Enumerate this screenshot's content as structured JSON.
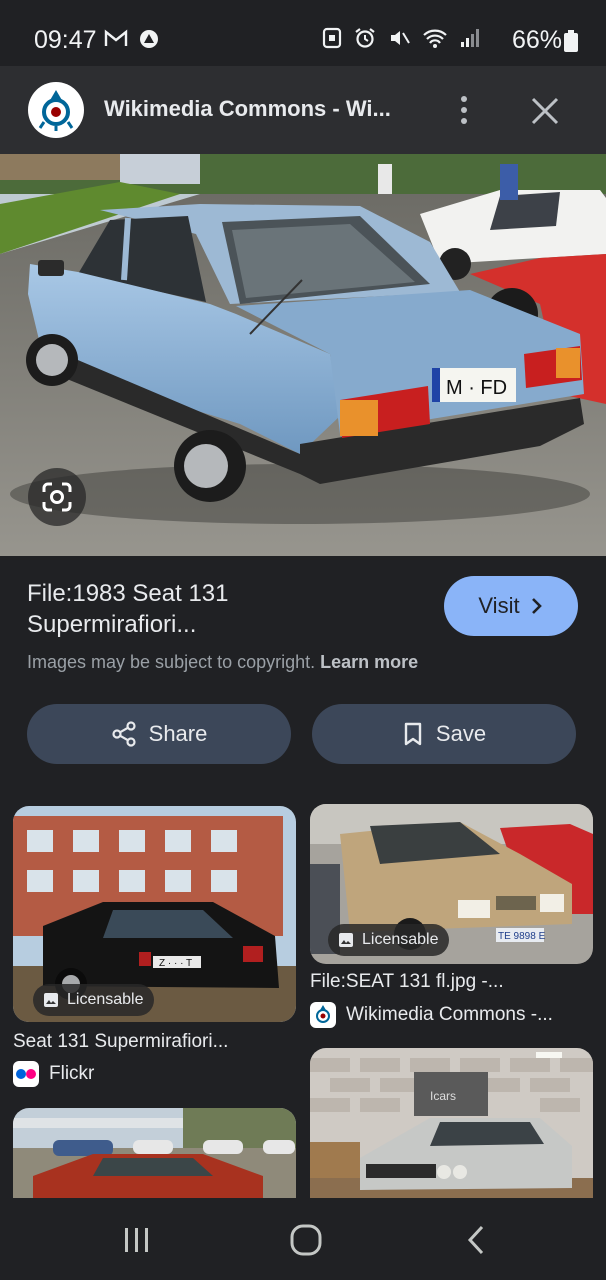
{
  "status_bar": {
    "time": "09:47",
    "battery": "66%",
    "left_icons": [
      "gmail-icon",
      "app-notification-icon"
    ],
    "right_icons": [
      "nfc-icon",
      "alarm-icon",
      "mute-icon",
      "wifi-icon",
      "signal-icon",
      "battery-icon"
    ]
  },
  "header": {
    "title": "Wikimedia Commons - Wi...",
    "logo_icon": "wikimedia-commons-logo-icon",
    "menu_icon": "more-vert-icon",
    "close_icon": "close-icon"
  },
  "main_image": {
    "subject": "light blue 1983 Seat 131 Supermirafiori sedan, rear three-quarter view",
    "plate": "M · FD",
    "lens_icon": "google-lens-icon"
  },
  "result": {
    "title_line1": "File:1983 Seat 131",
    "title_line2": "Supermirafiori...",
    "visit_label": "Visit",
    "copyright_text": "Images may be subject to copyright.",
    "learn_more": "Learn more"
  },
  "actions": {
    "share_label": "Share",
    "save_label": "Save"
  },
  "related": [
    {
      "title": "Seat 131 Supermirafiori...",
      "source": "Flickr",
      "badge": "Licensable",
      "plate": "Z · · · T"
    },
    {
      "title": "File:SEAT 131 fl.jpg -...",
      "source": "Wikimedia Commons -...",
      "badge": "Licensable",
      "plate": "TE 9898 E"
    },
    {
      "title": "",
      "source": "",
      "sign": "Icars"
    },
    {
      "title": "",
      "source": ""
    }
  ],
  "colors": {
    "background": "#202124",
    "header": "#2d2e31",
    "visit_button": "#8ab4f8",
    "action_button": "#3c4759"
  }
}
